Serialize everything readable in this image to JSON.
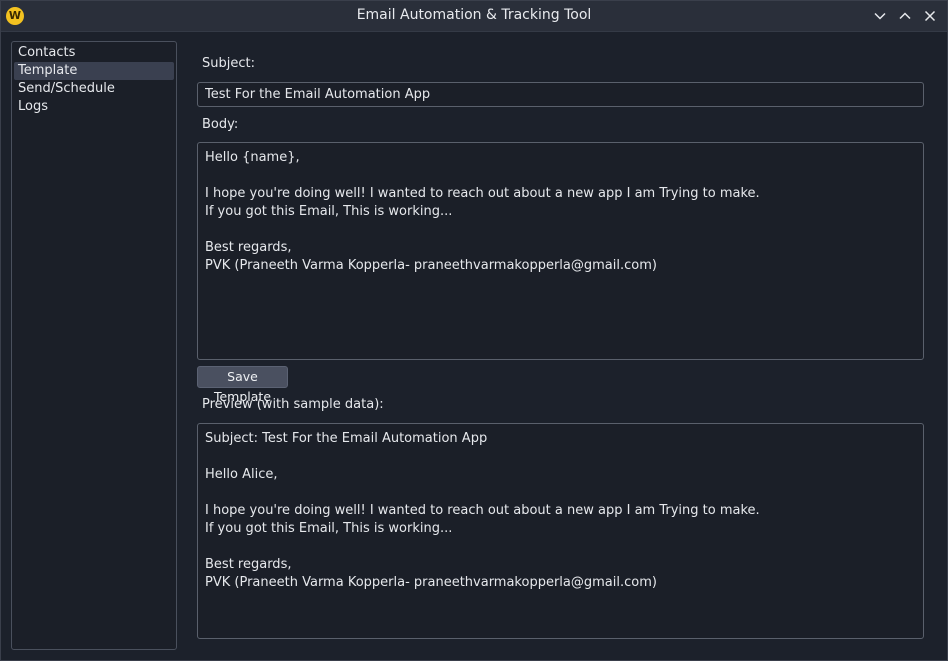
{
  "window": {
    "title": "Email Automation & Tracking Tool",
    "logo_letter": "W"
  },
  "sidebar": {
    "items": [
      {
        "label": "Contacts",
        "selected": false
      },
      {
        "label": "Template",
        "selected": true
      },
      {
        "label": "Send/Schedule",
        "selected": false
      },
      {
        "label": "Logs",
        "selected": false
      }
    ]
  },
  "template": {
    "subject_label": "Subject:",
    "subject_value": "Test For the Email Automation App",
    "body_label": "Body:",
    "body_value": "Hello {name},\n\nI hope you're doing well! I wanted to reach out about a new app I am Trying to make.\nIf you got this Email, This is working...\n\nBest regards,\nPVK (Praneeth Varma Kopperla- praneethvarmakopperla@gmail.com)",
    "save_label": "Save Template",
    "preview_label": "Preview (with sample data):",
    "preview_value": "Subject: Test For the Email Automation App\n\nHello Alice,\n\nI hope you're doing well! I wanted to reach out about a new app I am Trying to make.\nIf you got this Email, This is working...\n\nBest regards,\nPVK (Praneeth Varma Kopperla- praneethvarmakopperla@gmail.com)"
  },
  "icons": {
    "minimize": "chevron-down-icon",
    "maximize": "chevron-up-icon",
    "close": "close-icon"
  },
  "colors": {
    "logo": "#f3c220",
    "background": "#1c212b",
    "selection": "#3a4050",
    "button": "#4a5060"
  }
}
